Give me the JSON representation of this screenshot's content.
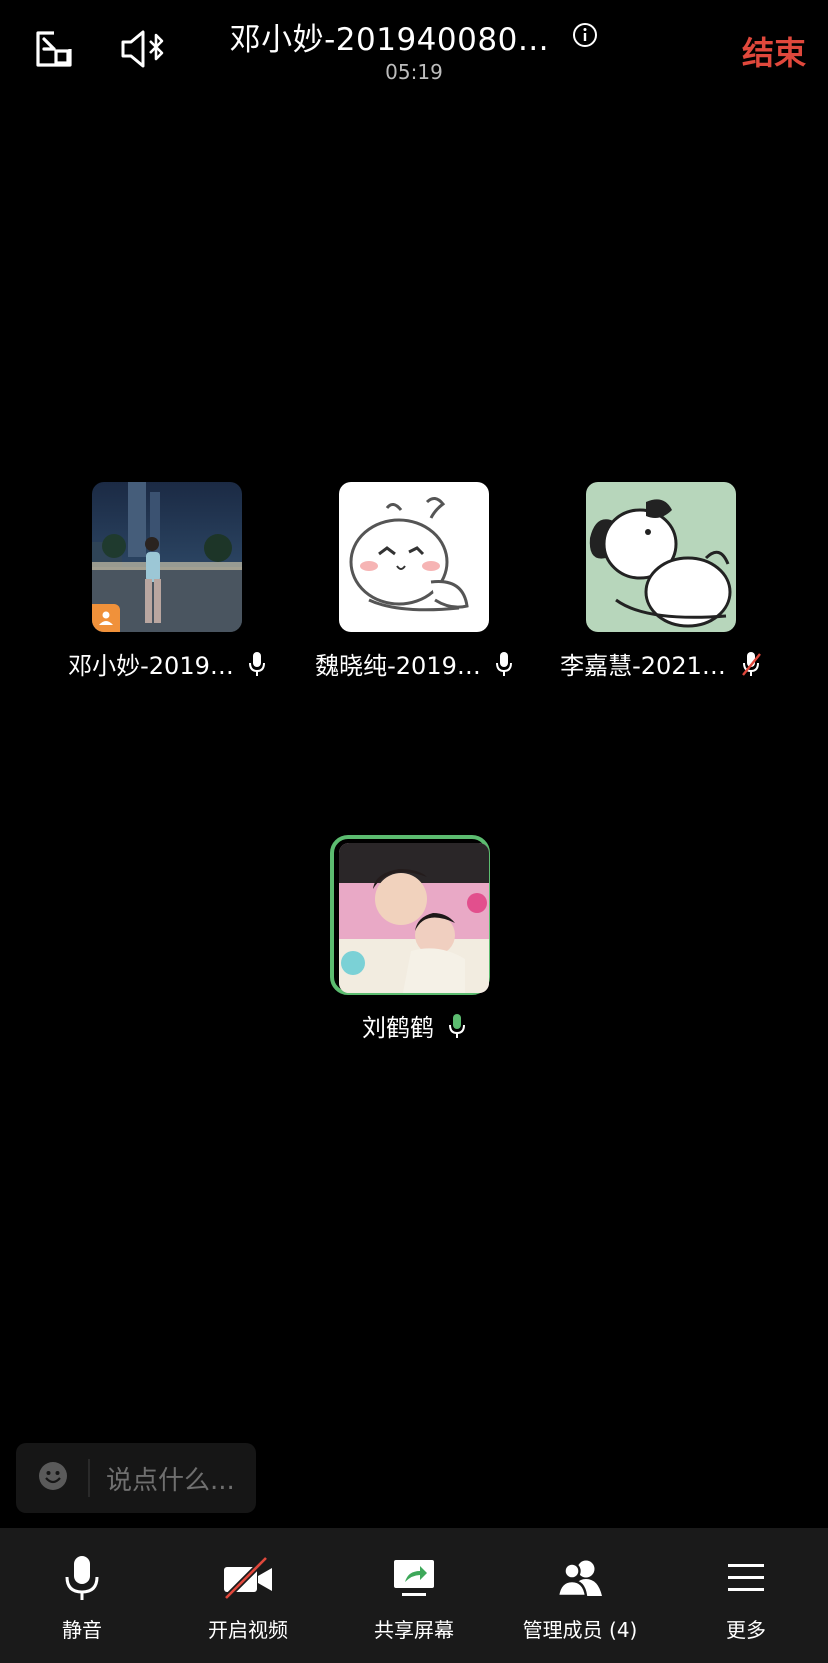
{
  "header": {
    "meeting_title": "邓小妙-201940080…",
    "timer": "05:19",
    "end_label": "结束"
  },
  "participants": [
    {
      "name": "邓小妙-2019…",
      "mic": "on",
      "host": true
    },
    {
      "name": "魏晓纯-2019…",
      "mic": "on",
      "host": false
    },
    {
      "name": "李嘉慧-2021…",
      "mic": "muted",
      "host": false
    },
    {
      "name": "刘鹤鹤",
      "mic": "speaking",
      "host": false
    }
  ],
  "chat": {
    "placeholder": "说点什么..."
  },
  "toolbar": {
    "mute_label": "静音",
    "video_label": "开启视频",
    "share_label": "共享屏幕",
    "members_label": "管理成员 (4)",
    "more_label": "更多"
  },
  "colors": {
    "end": "#e0483c",
    "speaking": "#5cbc70",
    "host_badge": "#f0913a",
    "mute_slash": "#e0483c"
  }
}
